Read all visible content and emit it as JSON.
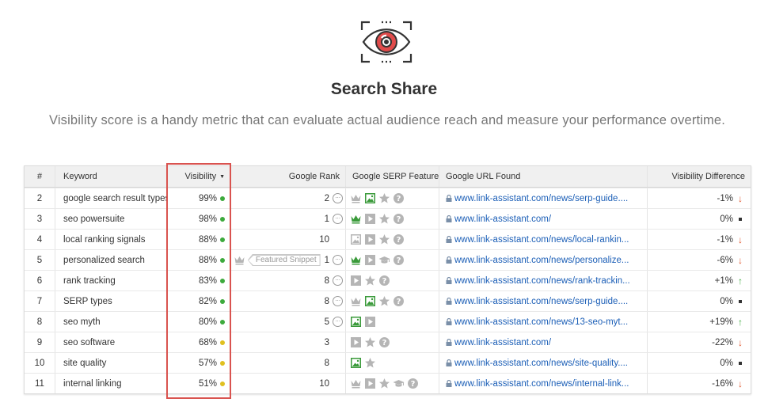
{
  "page": {
    "title": "Search Share",
    "subtitle": "Visibility score is a handy metric that can evaluate actual audience reach and measure your performance overtime."
  },
  "colors": {
    "accent_red": "#d9534f",
    "dot_green": "#3daa3d",
    "dot_yellow": "#e0c020",
    "arrow_down": "#e0552c",
    "arrow_up": "#3daa3d",
    "link_blue": "#1c5fb7",
    "icon_gray": "#b5b5b5",
    "icon_green": "#3a9a3a"
  },
  "table": {
    "headers": {
      "num": "#",
      "keyword": "Keyword",
      "visibility": "Visibility",
      "google_rank": "Google Rank",
      "serp_features": "Google SERP Features",
      "url": "Google URL Found",
      "diff": "Visibility Difference"
    },
    "sort_indicator": "caret-down-icon",
    "rows": [
      {
        "num": "2",
        "keyword": "google search result types",
        "visibility": "99%",
        "dot": "green",
        "snippet": false,
        "rank": "2",
        "rank_icon": true,
        "features": [
          "crown-gray",
          "image-green",
          "star-gray",
          "question-gray"
        ],
        "url": "www.link-assistant.com/news/serp-guide....",
        "diff": "-1%",
        "trend": "down"
      },
      {
        "num": "3",
        "keyword": "seo powersuite",
        "visibility": "98%",
        "dot": "green",
        "snippet": false,
        "rank": "1",
        "rank_icon": true,
        "features": [
          "crown-green",
          "video-gray",
          "star-gray",
          "question-gray"
        ],
        "url": "www.link-assistant.com/",
        "diff": "0%",
        "trend": "flat"
      },
      {
        "num": "4",
        "keyword": "local ranking signals",
        "visibility": "88%",
        "dot": "green",
        "snippet": false,
        "rank": "10",
        "rank_icon": false,
        "features": [
          "image-gray",
          "video-gray",
          "star-gray",
          "question-gray"
        ],
        "url": "www.link-assistant.com/news/local-rankin...",
        "diff": "-1%",
        "trend": "down"
      },
      {
        "num": "5",
        "keyword": "personalized search",
        "visibility": "88%",
        "dot": "green",
        "snippet": true,
        "snippet_label": "Featured Snippet",
        "rank": "1",
        "rank_icon": true,
        "features": [
          "crown-green",
          "video-gray",
          "mortarboard-gray",
          "question-gray"
        ],
        "url": "www.link-assistant.com/news/personalize...",
        "diff": "-6%",
        "trend": "down"
      },
      {
        "num": "6",
        "keyword": "rank tracking",
        "visibility": "83%",
        "dot": "green",
        "snippet": false,
        "rank": "8",
        "rank_icon": true,
        "features": [
          "video-gray",
          "star-gray",
          "question-gray"
        ],
        "url": "www.link-assistant.com/news/rank-trackin...",
        "diff": "+1%",
        "trend": "up"
      },
      {
        "num": "7",
        "keyword": "SERP types",
        "visibility": "82%",
        "dot": "green",
        "snippet": false,
        "rank": "8",
        "rank_icon": true,
        "features": [
          "crown-gray",
          "image-green",
          "star-gray",
          "question-gray"
        ],
        "url": "www.link-assistant.com/news/serp-guide....",
        "diff": "0%",
        "trend": "flat"
      },
      {
        "num": "8",
        "keyword": "seo myth",
        "visibility": "80%",
        "dot": "green",
        "snippet": false,
        "rank": "5",
        "rank_icon": true,
        "features": [
          "image-green",
          "video-gray"
        ],
        "url": "www.link-assistant.com/news/13-seo-myt...",
        "diff": "+19%",
        "trend": "up"
      },
      {
        "num": "9",
        "keyword": "seo software",
        "visibility": "68%",
        "dot": "yellow",
        "snippet": false,
        "rank": "3",
        "rank_icon": false,
        "features": [
          "video-gray",
          "star-gray",
          "question-gray"
        ],
        "url": "www.link-assistant.com/",
        "diff": "-22%",
        "trend": "down"
      },
      {
        "num": "10",
        "keyword": "site quality",
        "visibility": "57%",
        "dot": "yellow",
        "snippet": false,
        "rank": "8",
        "rank_icon": false,
        "features": [
          "image-green",
          "star-gray"
        ],
        "url": "www.link-assistant.com/news/site-quality....",
        "diff": "0%",
        "trend": "flat"
      },
      {
        "num": "11",
        "keyword": "internal linking",
        "visibility": "51%",
        "dot": "yellow",
        "snippet": false,
        "rank": "10",
        "rank_icon": false,
        "features": [
          "crown-gray",
          "video-gray",
          "star-gray",
          "mortarboard-gray",
          "question-gray"
        ],
        "url": "www.link-assistant.com/news/internal-link...",
        "diff": "-16%",
        "trend": "down"
      }
    ]
  }
}
